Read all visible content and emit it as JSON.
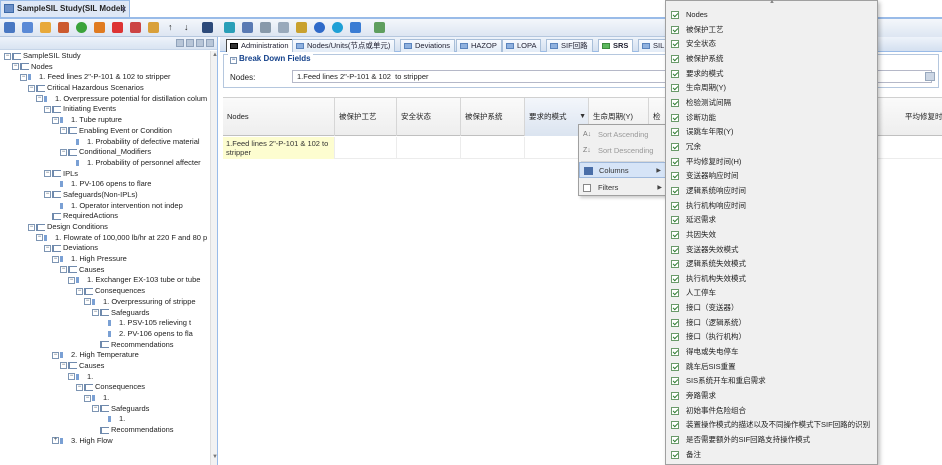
{
  "window": {
    "tab_title": "SampleSIL Study(SIL Model)",
    "close": "×"
  },
  "tree": {
    "rows": [
      {
        "label": "SampleSIL Study",
        "indent": 0,
        "exp": "−",
        "icon": "folder"
      },
      {
        "label": "Nodes",
        "indent": 1,
        "exp": "−",
        "icon": "folder"
      },
      {
        "label": "1. Feed lines 2\"-P-101 & 102 to stripper",
        "indent": 2,
        "exp": "−",
        "icon": "leaf"
      },
      {
        "label": "Critical Hazardous Scenarios",
        "indent": 3,
        "exp": "−",
        "icon": "folder"
      },
      {
        "label": "1. Overpressure potential for distillation colum",
        "indent": 4,
        "exp": "−",
        "icon": "leaf"
      },
      {
        "label": "Initiating Events",
        "indent": 5,
        "exp": "−",
        "icon": "folder"
      },
      {
        "label": "1. Tube rupture",
        "indent": 6,
        "exp": "−",
        "icon": "leaf"
      },
      {
        "label": "Enabling Event or Condition",
        "indent": 7,
        "exp": "−",
        "icon": "folder"
      },
      {
        "label": "1. Probability of defective material",
        "indent": 8,
        "exp": "",
        "icon": "leaf"
      },
      {
        "label": "Conditional_Modifiers",
        "indent": 7,
        "exp": "−",
        "icon": "folder"
      },
      {
        "label": "1. Probability of personnel affecter",
        "indent": 8,
        "exp": "",
        "icon": "leaf"
      },
      {
        "label": "IPLs",
        "indent": 5,
        "exp": "−",
        "icon": "folder"
      },
      {
        "label": "1. PV-106 opens to flare",
        "indent": 6,
        "exp": "",
        "icon": "leaf"
      },
      {
        "label": "Safeguards(Non-IPLs)",
        "indent": 5,
        "exp": "−",
        "icon": "folder"
      },
      {
        "label": "1. Operator intervention not indep",
        "indent": 6,
        "exp": "",
        "icon": "leaf"
      },
      {
        "label": "RequiredActions",
        "indent": 5,
        "exp": "",
        "icon": "folder"
      },
      {
        "label": "Design Conditions",
        "indent": 3,
        "exp": "−",
        "icon": "folder"
      },
      {
        "label": "1. Flowrate of 100,000 lb/hr at 220 F and 80 p",
        "indent": 4,
        "exp": "−",
        "icon": "leaf"
      },
      {
        "label": "Deviations",
        "indent": 5,
        "exp": "−",
        "icon": "folder"
      },
      {
        "label": "1. High Pressure",
        "indent": 6,
        "exp": "−",
        "icon": "leaf"
      },
      {
        "label": "Causes",
        "indent": 7,
        "exp": "−",
        "icon": "folder"
      },
      {
        "label": "1. Exchanger EX-103 tube or tube",
        "indent": 8,
        "exp": "−",
        "icon": "leaf"
      },
      {
        "label": "Consequences",
        "indent": 9,
        "exp": "−",
        "icon": "folder"
      },
      {
        "label": "1. Overpressuring of strippe",
        "indent": 10,
        "exp": "−",
        "icon": "leaf"
      },
      {
        "label": "Safeguards",
        "indent": 11,
        "exp": "−",
        "icon": "folder"
      },
      {
        "label": "1. PSV-105 relieving t",
        "indent": 12,
        "exp": "",
        "icon": "leaf"
      },
      {
        "label": "2. PV-106 opens to fla",
        "indent": 12,
        "exp": "",
        "icon": "leaf"
      },
      {
        "label": "Recommendations",
        "indent": 11,
        "exp": "",
        "icon": "folder"
      },
      {
        "label": "2. High Temperature",
        "indent": 6,
        "exp": "−",
        "icon": "leaf"
      },
      {
        "label": "Causes",
        "indent": 7,
        "exp": "−",
        "icon": "folder"
      },
      {
        "label": "1.",
        "indent": 8,
        "exp": "−",
        "icon": "leaf"
      },
      {
        "label": "Consequences",
        "indent": 9,
        "exp": "−",
        "icon": "folder"
      },
      {
        "label": "1.",
        "indent": 10,
        "exp": "−",
        "icon": "leaf"
      },
      {
        "label": "Safeguards",
        "indent": 11,
        "exp": "−",
        "icon": "folder"
      },
      {
        "label": "1.",
        "indent": 12,
        "exp": "",
        "icon": "leaf"
      },
      {
        "label": "Recommendations",
        "indent": 11,
        "exp": "",
        "icon": "folder"
      },
      {
        "label": "3. High Flow",
        "indent": 6,
        "exp": "+",
        "icon": "leaf"
      }
    ]
  },
  "tabs": [
    "Administration",
    "Nodes/Units(节点或单元)",
    "Deviations",
    "HAZOP",
    "LOPA",
    "SIF回路",
    "SRS",
    "SIL"
  ],
  "break_down": {
    "title": "Break Down Fields",
    "nodes_label": "Nodes:",
    "nodes_value": "1.Feed lines 2\"-P-101 & 102  to stripper"
  },
  "grid": {
    "headers": [
      "Nodes",
      "被保护工艺",
      "安全状态",
      "被保护系统",
      "要求的模式",
      "生命周期(Y)",
      "检",
      "平均修复时"
    ],
    "row_first": "1.Feed lines 2\"-P-101 & 102 to stripper"
  },
  "context_menu": {
    "sort_asc": "Sort Ascending",
    "sort_desc": "Sort Descending",
    "columns": "Columns",
    "filters": "Filters"
  },
  "column_menu": {
    "items": [
      "Nodes",
      "被保护工艺",
      "安全状态",
      "被保护系统",
      "要求的模式",
      "生命周期(Y)",
      "检验测试间隔",
      "诊断功能",
      "误跳车年限(Y)",
      "冗余",
      "平均修复时间(H)",
      "变送器响应时间",
      "逻辑系统响应时间",
      "执行机构响应时间",
      "延迟需求",
      "共因失效",
      "变送器失效模式",
      "逻辑系统失效模式",
      "执行机构失效模式",
      "人工停车",
      "接口（变送器）",
      "接口（逻辑系统）",
      "接口（执行机构）",
      "得电或失电停车",
      "跳车后SIS重置",
      "SIS系统开车和重启需求",
      "旁路需求",
      "初始事件危险组合",
      "装置操作模式的描述以及不同操作模式下SIF回路的识别",
      "是否需要额外的SIF回路支持操作模式",
      "备注"
    ]
  },
  "colors": {
    "accent": "#99bbe8",
    "title_text": "#15428b",
    "check": "#2e7d32",
    "row_highlight": "#fdfdd0"
  }
}
